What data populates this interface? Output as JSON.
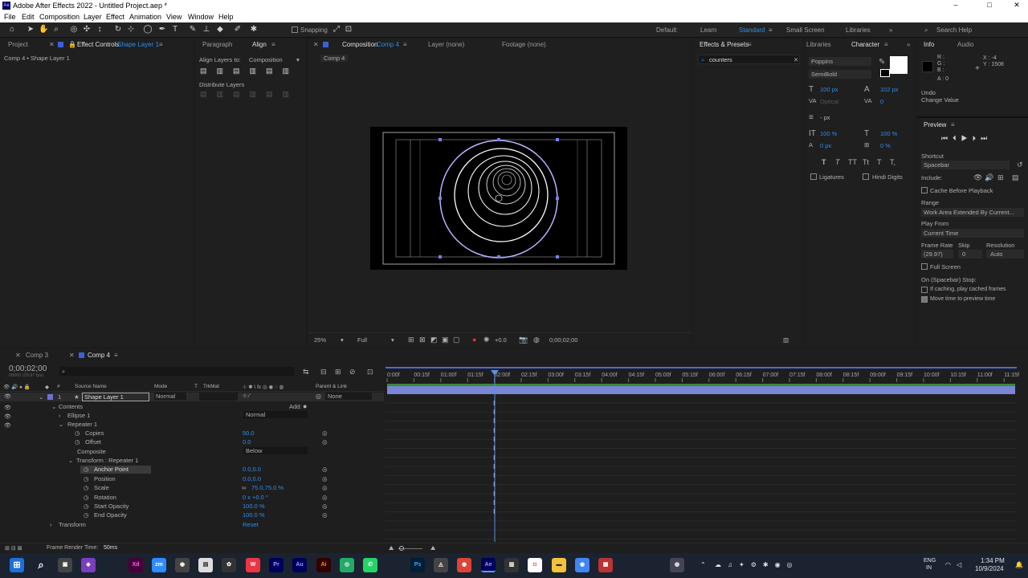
{
  "window": {
    "title": "Adobe After Effects 2022 - Untitled Project.aep *",
    "app_icon": "Ae",
    "minimize": "–",
    "maximize": "□",
    "close": "✕"
  },
  "menu": [
    "File",
    "Edit",
    "Composition",
    "Layer",
    "Effect",
    "Animation",
    "View",
    "Window",
    "Help"
  ],
  "toolbar": {
    "snapping": "Snapping",
    "workspaces": [
      "Default",
      "Learn",
      "Standard",
      "Small Screen",
      "Libraries"
    ],
    "search_placeholder": "Search Help"
  },
  "left_panel": {
    "tabs": [
      "Project",
      "Effect Controls",
      "Shape Layer 1"
    ],
    "subtitle": "Comp 4 • Shape Layer 1"
  },
  "align_panel": {
    "tabs": [
      "Paragraph",
      "Align"
    ],
    "align_layers_to_label": "Align Layers to:",
    "align_layers_to_value": "Composition",
    "distribute_label": "Distribute Layers"
  },
  "comp_panel": {
    "tabs": [
      "Composition",
      "Comp 4",
      "Layer  (none)",
      "Footage  (none)"
    ],
    "breadcrumb": "Comp 4",
    "zoom": "25%",
    "resolution": "Full",
    "exposure": "+0.0",
    "timecode": "0;00;02;00"
  },
  "effects_presets": {
    "title": "Effects & Presets",
    "search_value": "counters"
  },
  "character_panel": {
    "tabs": [
      "Libraries",
      "Character"
    ],
    "font": "Poppins",
    "style": "SemiBold",
    "size": "100 px",
    "leading": "102 px",
    "kerning": "Optical",
    "tracking": "0",
    "stroke_unit": "- px",
    "vscale": "100 %",
    "hscale": "100 %",
    "baseline": "0 px",
    "tsume": "0 %",
    "text_styles": [
      "T",
      "T",
      "TT",
      "Tt",
      "T",
      "T,"
    ],
    "ligatures": "Ligatures",
    "hindi_digits": "Hindi Digits"
  },
  "info_panel": {
    "tabs": [
      "Info",
      "Audio"
    ],
    "r": "R :",
    "g": "G :",
    "b": "B :",
    "a": "A : 0",
    "x": "X : -4",
    "y": "Y : 1508",
    "undo": "Undo",
    "change_value": "Change Value"
  },
  "preview_panel": {
    "title": "Preview",
    "shortcut_label": "Shortcut",
    "shortcut_value": "Spacebar",
    "include_label": "Include:",
    "cache_before": "Cache Before Playback",
    "range_label": "Range",
    "range_value": "Work Area Extended By Current...",
    "play_from_label": "Play From",
    "play_from_value": "Current Time",
    "frame_rate_label": "Frame Rate",
    "skip_label": "Skip",
    "resolution_label": "Resolution",
    "frame_rate_value": "(29.97)",
    "skip_value": "0",
    "resolution_value": "Auto",
    "full_screen": "Full Screen",
    "on_stop": "On (Spacebar) Stop:",
    "if_caching": "If caching, play cached frames",
    "move_time": "Move time to preview time"
  },
  "timeline": {
    "tabs": [
      "Comp 3",
      "Comp 4"
    ],
    "timecode": "0;00;02;00",
    "fps_note": "00060 (29.97 fps)",
    "columns": [
      "Source Name",
      "Mode",
      "T",
      "TrkMat",
      "Parent & Link"
    ],
    "ruler": [
      "0:00f",
      "00:15f",
      "01:00f",
      "01:15f",
      "02:00f",
      "02:15f",
      "03:00f",
      "03:15f",
      "04:00f",
      "04:15f",
      "05:00f",
      "05:15f",
      "06:00f",
      "06:15f",
      "07:00f",
      "07:15f",
      "08:00f",
      "08:15f",
      "09:00f",
      "09:15f",
      "10:00f",
      "10:15f",
      "11:00f",
      "11:15f"
    ],
    "layer": {
      "index": "1",
      "name": "Shape Layer 1",
      "mode": "Normal",
      "parent": "None"
    },
    "contents_label": "Contents",
    "add_label": "Add:",
    "ellipse_label": "Ellipse 1",
    "ellipse_mode": "Normal",
    "repeater_label": "Repeater 1",
    "copies_label": "Copies",
    "copies_value": "50.0",
    "offset_label": "Offset",
    "offset_value": "0.0",
    "composite_label": "Composite",
    "composite_value": "Below",
    "transform_repeater_label": "Transform : Repeater 1",
    "anchor_label": "Anchor Point",
    "anchor_value": "0.0,0.0",
    "position_label": "Position",
    "position_value": "0.0,0.0",
    "scale_label": "Scale",
    "scale_value": "75.0,75.0 %",
    "rotation_label": "Rotation",
    "rotation_value": "0 x +0.0 °",
    "start_opacity_label": "Start Opacity",
    "start_opacity_value": "100.0 %",
    "end_opacity_label": "End Opacity",
    "end_opacity_value": "100.0 %",
    "transform_label": "Transform",
    "transform_value": "Reset",
    "render_time_label": "Frame Render Time:",
    "render_time_value": "50ms"
  },
  "taskbar": {
    "apps": [
      "Xd",
      "zm",
      "Pr",
      "Au",
      "Ai",
      "Ps",
      "Ae"
    ],
    "lang1": "ENG",
    "lang2": "IN",
    "time": "1:34 PM",
    "date": "10/9/2024"
  },
  "colors": {
    "accent": "#2d8ceb",
    "layer_bar": "#7b85d6",
    "workarea": "#3a8a3a",
    "shape_stroke": "#ffffff"
  }
}
